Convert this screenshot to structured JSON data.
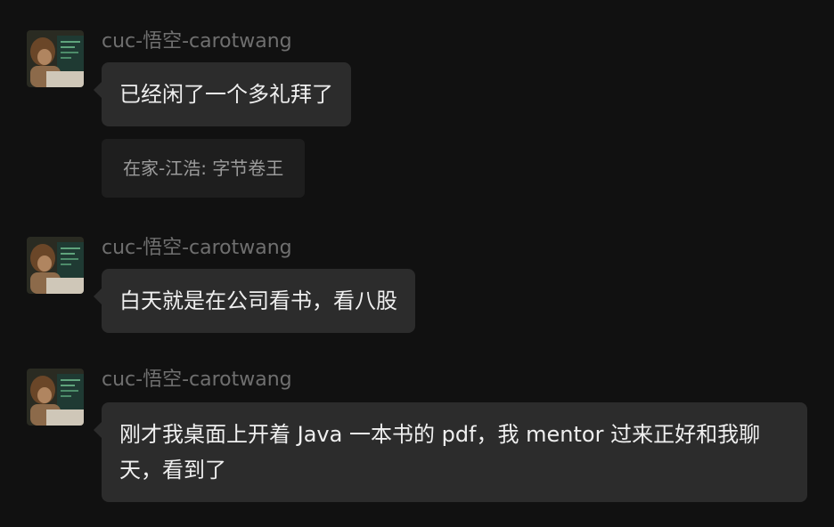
{
  "messages": [
    {
      "sender": "cuc-悟空-carotwang",
      "text": "已经闲了一个多礼拜了",
      "quote": "在家-江浩: 字节卷王"
    },
    {
      "sender": "cuc-悟空-carotwang",
      "text": "白天就是在公司看书，看八股"
    },
    {
      "sender": "cuc-悟空-carotwang",
      "text": "刚才我桌面上开着 Java 一本书的 pdf，我 mentor 过来正好和我聊天，看到了"
    }
  ],
  "colors": {
    "background": "#111111",
    "bubble": "#2c2c2c",
    "bubble_text": "#efefef",
    "sender_text": "#6f6f6f",
    "quote_bg": "#1e1e1e",
    "quote_text": "#9b9b9b"
  }
}
